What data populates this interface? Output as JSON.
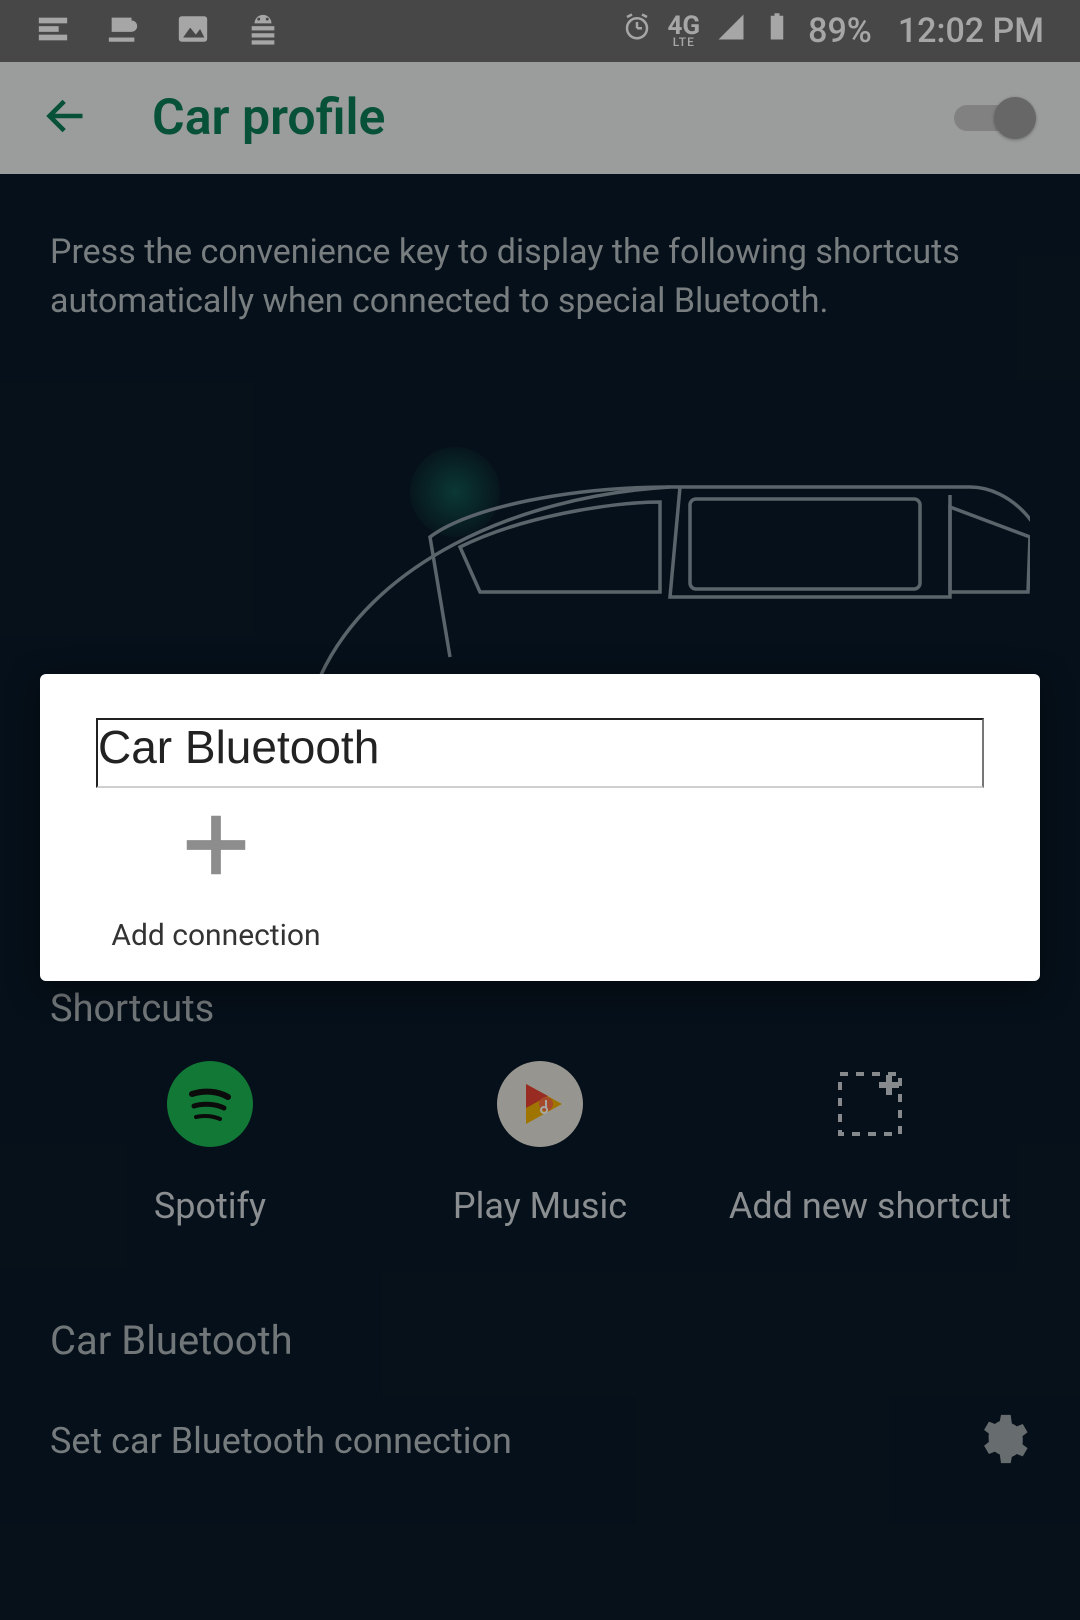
{
  "status_bar": {
    "network_label": "4G",
    "network_sub": "LTE",
    "battery_pct": "89%",
    "time": "12:02 PM"
  },
  "header": {
    "title": "Car profile",
    "toggle_on": false
  },
  "description": "Press the convenience key to display the following shortcuts automatically when connected to special Bluetooth.",
  "dialog": {
    "title_value": "Car Bluetooth",
    "add_label": "Add connection"
  },
  "shortcuts": {
    "title": "Shortcuts",
    "items": [
      {
        "label": "Spotify"
      },
      {
        "label": "Play Music"
      },
      {
        "label": "Add new shortcut"
      }
    ]
  },
  "bluetooth_section": {
    "title": "Car Bluetooth",
    "set_label": "Set car Bluetooth connection"
  }
}
